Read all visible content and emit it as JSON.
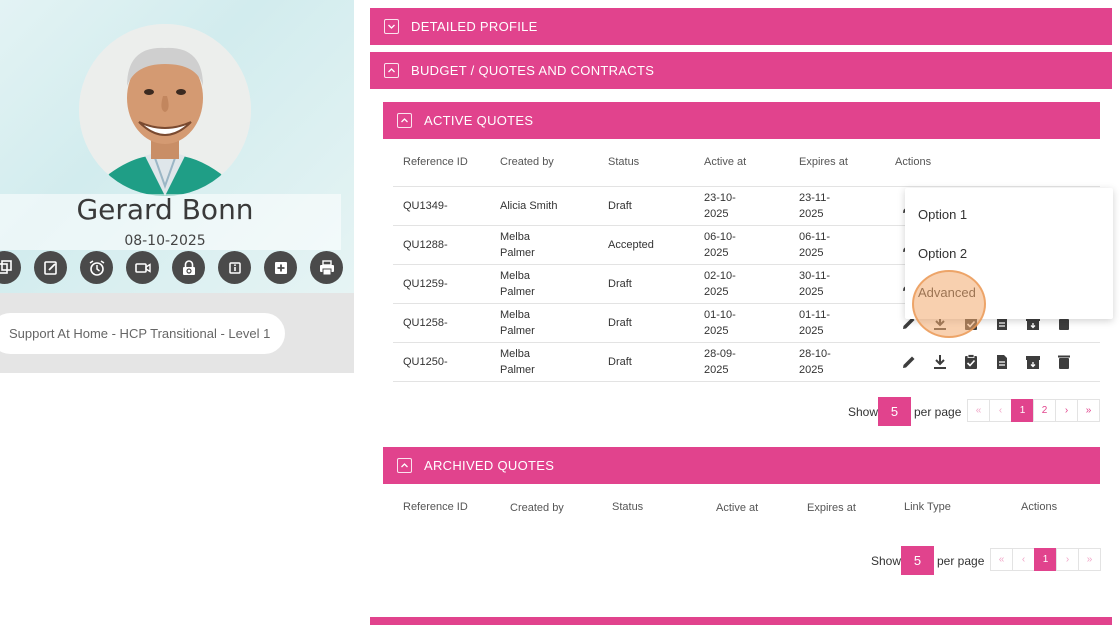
{
  "profile": {
    "name": "Gerard Bonn",
    "date": "08-10-2025",
    "program": "Support At Home - HCP Transitional - Level 1"
  },
  "sections": {
    "detailed_profile": "DETAILED PROFILE",
    "budget": "BUDGET / QUOTES AND CONTRACTS",
    "active_quotes": "ACTIVE QUOTES",
    "archived_quotes": "ARCHIVED QUOTES"
  },
  "active_table": {
    "headers": [
      "Reference ID",
      "Created by",
      "Status",
      "Active at",
      "Expires at",
      "Actions"
    ],
    "rows": [
      {
        "ref": "QU1349-",
        "by1": "Alicia Smith",
        "by2": "",
        "status": "Draft",
        "active1": "23-10-",
        "active2": "2025",
        "exp1": "23-11-",
        "exp2": "2025"
      },
      {
        "ref": "QU1288-",
        "by1": "Melba",
        "by2": "Palmer",
        "status": "Accepted",
        "active1": "06-10-",
        "active2": "2025",
        "exp1": "06-11-",
        "exp2": "2025"
      },
      {
        "ref": "QU1259-",
        "by1": "Melba",
        "by2": "Palmer",
        "status": "Draft",
        "active1": "02-10-",
        "active2": "2025",
        "exp1": "30-11-",
        "exp2": "2025"
      },
      {
        "ref": "QU1258-",
        "by1": "Melba",
        "by2": "Palmer",
        "status": "Draft",
        "active1": "01-10-",
        "active2": "2025",
        "exp1": "01-11-",
        "exp2": "2025"
      },
      {
        "ref": "QU1250-",
        "by1": "Melba",
        "by2": "Palmer",
        "status": "Draft",
        "active1": "28-09-",
        "active2": "2025",
        "exp1": "28-10-",
        "exp2": "2025"
      }
    ],
    "show_label": "Show",
    "per_page_value": "5",
    "per_page_label": "per page",
    "pager": [
      "«",
      "‹",
      "1",
      "2",
      "›",
      "»"
    ]
  },
  "archived_table": {
    "headers": [
      "Reference ID",
      "Created by",
      "Status",
      "Active at",
      "Expires at",
      "Link Type",
      "Actions"
    ],
    "show_label": "Show",
    "per_page_value": "5",
    "per_page_label": "per page",
    "pager": [
      "«",
      "‹",
      "1",
      "›",
      "»"
    ]
  },
  "dropdown": {
    "items": [
      "Option 1",
      "Option 2",
      "Advanced"
    ]
  },
  "colors": {
    "accent": "#e1438d",
    "icon_dark": "#3d3d3d",
    "click_highlight": "#f2aa6e"
  }
}
